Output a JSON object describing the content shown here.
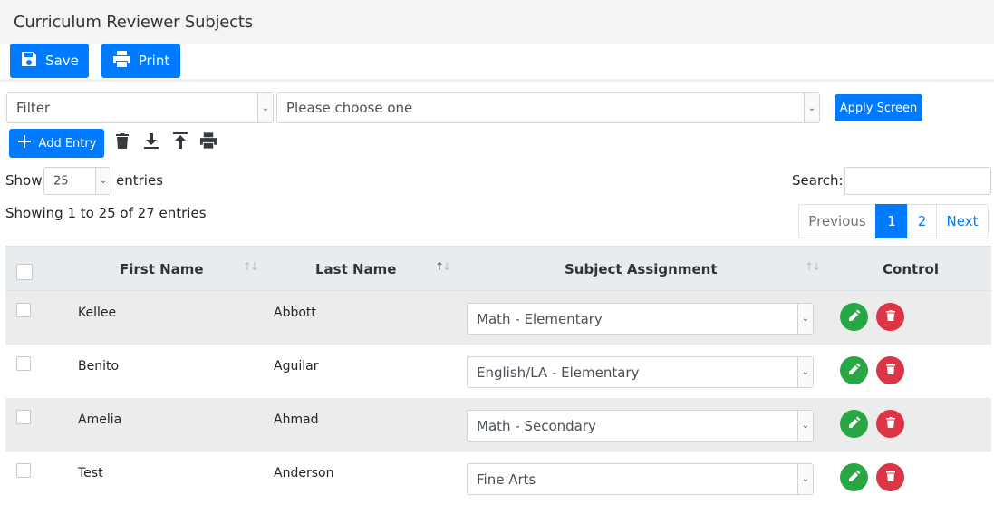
{
  "page": {
    "title": "Curriculum Reviewer Subjects"
  },
  "toolbar": {
    "save_label": "Save",
    "print_label": "Print"
  },
  "filter": {
    "field_value": "Filter",
    "choice_value": "Please choose one",
    "apply_label": "Apply Screen"
  },
  "actions": {
    "add_entry_label": "Add Entry"
  },
  "length": {
    "show_label": "Show",
    "value": "25",
    "entries_label": "entries"
  },
  "search": {
    "label": "Search:",
    "value": ""
  },
  "info": "Showing 1 to 25 of 27 entries",
  "pagination": {
    "previous": "Previous",
    "pages": [
      "1",
      "2"
    ],
    "active": "1",
    "next": "Next"
  },
  "table": {
    "columns": [
      "First Name",
      "Last Name",
      "Subject Assignment",
      "Control"
    ],
    "rows": [
      {
        "first": "Kellee",
        "last": "Abbott",
        "subject": "Math - Elementary"
      },
      {
        "first": "Benito",
        "last": "Aguilar",
        "subject": "English/LA - Elementary"
      },
      {
        "first": "Amelia",
        "last": "Ahmad",
        "subject": "Math - Secondary"
      },
      {
        "first": "Test",
        "last": "Anderson",
        "subject": "Fine Arts"
      }
    ]
  },
  "colors": {
    "primary": "#007bff",
    "success": "#28a745",
    "danger": "#dc3545",
    "header_bg": "#f4f4f4",
    "row_stripe": "#ececec"
  }
}
